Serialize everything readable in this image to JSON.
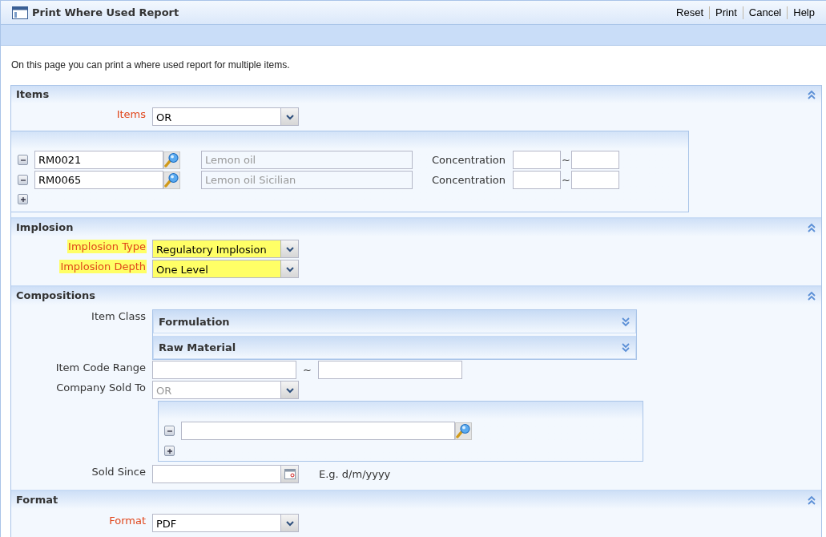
{
  "window": {
    "title": "Print Where Used Report"
  },
  "toolbar": [
    "Reset",
    "Print",
    "Cancel",
    "Help"
  ],
  "intro": "On this page you can print a where used report for multiple items.",
  "sections": [
    {
      "kind": "items",
      "title": "Items",
      "expanded": true,
      "mode": {
        "label": "Items",
        "required": true,
        "value": "OR"
      },
      "rows": [
        {
          "code": "RM0021",
          "description": "Lemon oil",
          "concentration_label": "Concentration",
          "separator": "~"
        },
        {
          "code": "RM0065",
          "description": "Lemon oil Sicilian",
          "concentration_label": "Concentration",
          "separator": "~"
        }
      ]
    },
    {
      "kind": "implosion",
      "title": "Implosion",
      "expanded": true,
      "fields": [
        {
          "label": "Implosion Type",
          "value": "Regulatory Implosion",
          "highlighted": true
        },
        {
          "label": "Implosion Depth",
          "value": "One Level",
          "highlighted": true
        }
      ]
    },
    {
      "kind": "compositions",
      "title": "Compositions",
      "expanded": true,
      "item_class": {
        "label": "Item Class",
        "groups": [
          {
            "title": "Formulation",
            "expanded": false
          },
          {
            "title": "Raw Material",
            "expanded": false
          }
        ]
      },
      "code_range": {
        "label": "Item Code Range",
        "separator": "~"
      },
      "company": {
        "label": "Company Sold To",
        "value": "OR",
        "disabled": true
      },
      "sold_since": {
        "label": "Sold Since",
        "hint": "E.g. d/m/yyyy"
      }
    },
    {
      "kind": "format",
      "title": "Format",
      "expanded": true,
      "field": {
        "label": "Format",
        "value": "PDF",
        "required": true
      }
    }
  ]
}
